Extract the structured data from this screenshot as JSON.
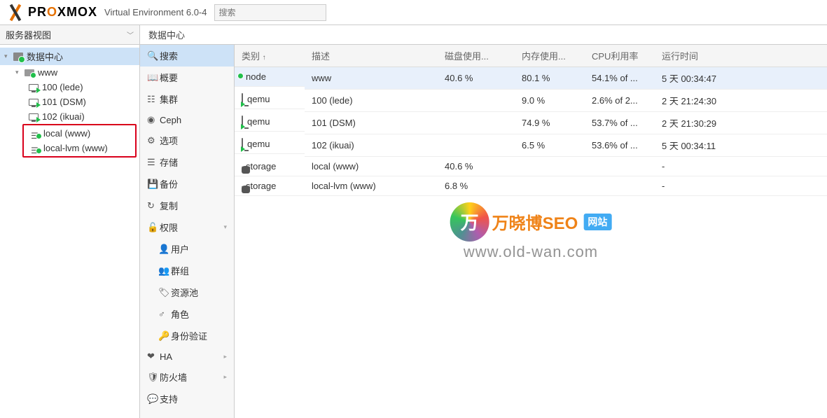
{
  "header": {
    "brand_pre": "PR",
    "brand_ox": "O",
    "brand_post": "XMOX",
    "version": "Virtual Environment 6.0-4",
    "search_placeholder": "搜索"
  },
  "sidebar": {
    "view_label": "服务器视图",
    "datacenter": "数据中心",
    "node": "www",
    "vms": [
      {
        "label": "100 (lede)"
      },
      {
        "label": "101 (DSM)"
      },
      {
        "label": "102 (ikuai)"
      }
    ],
    "storages": [
      {
        "label": "local (www)"
      },
      {
        "label": "local-lvm (www)"
      }
    ]
  },
  "breadcrumb": "数据中心",
  "menu": {
    "search": "搜索",
    "summary": "概要",
    "cluster": "集群",
    "ceph": "Ceph",
    "options": "选项",
    "storage": "存储",
    "backup": "备份",
    "replication": "复制",
    "permissions": "权限",
    "users": "用户",
    "groups": "群组",
    "pools": "资源池",
    "roles": "角色",
    "auth": "身份验证",
    "ha": "HA",
    "firewall": "防火墙",
    "support": "支持"
  },
  "table": {
    "headers": {
      "type": "类别",
      "desc": "描述",
      "disk": "磁盘使用...",
      "mem": "内存使用...",
      "cpu": "CPU利用率",
      "uptime": "运行时间"
    },
    "rows": [
      {
        "type": "node",
        "desc": "www",
        "disk": "40.6 %",
        "mem": "80.1 %",
        "cpu": "54.1% of ...",
        "uptime": "5 天 00:34:47"
      },
      {
        "type": "qemu",
        "desc": "100 (lede)",
        "disk": "",
        "mem": "9.0 %",
        "cpu": "2.6% of 2...",
        "uptime": "2 天 21:24:30"
      },
      {
        "type": "qemu",
        "desc": "101 (DSM)",
        "disk": "",
        "mem": "74.9 %",
        "cpu": "53.7% of ...",
        "uptime": "2 天 21:30:29"
      },
      {
        "type": "qemu",
        "desc": "102 (ikuai)",
        "disk": "",
        "mem": "6.5 %",
        "cpu": "53.6% of ...",
        "uptime": "5 天 00:34:11"
      },
      {
        "type": "storage",
        "desc": "local (www)",
        "disk": "40.6 %",
        "mem": "",
        "cpu": "",
        "uptime": "-"
      },
      {
        "type": "storage",
        "desc": "local-lvm (www)",
        "disk": "6.8 %",
        "mem": "",
        "cpu": "",
        "uptime": "-"
      }
    ]
  },
  "watermark": {
    "char": "万",
    "text1": "万晓博SEO",
    "badge": "网站",
    "url": "www.old-wan.com"
  }
}
